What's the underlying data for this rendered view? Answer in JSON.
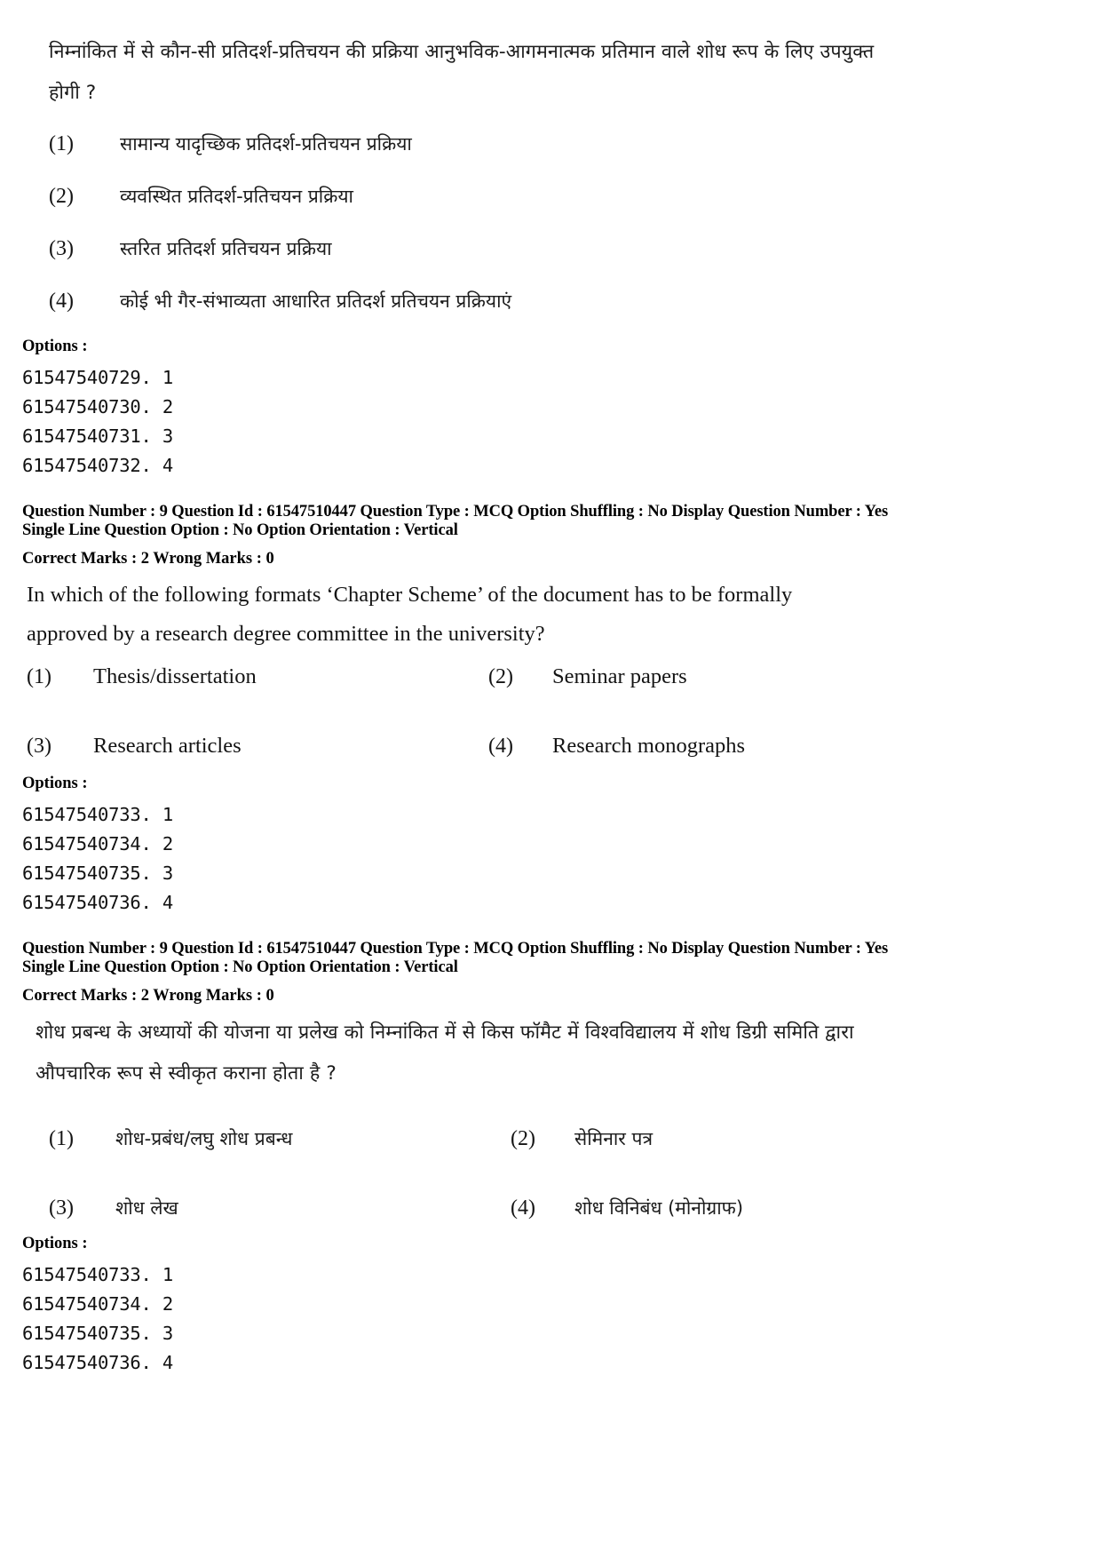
{
  "document": {
    "type": "exam-question-paper-answer-key",
    "language_mix": "Hindi and English"
  },
  "question_1_hindi": {
    "stem_line_1": "निम्नांकित में से कौन-सी प्रतिदर्श-प्रतिचयन की प्रक्रिया आनुभविक-आगमनात्मक प्रतिमान वाले शोध रूप के लिए उपयुक्त",
    "stem_line_2": "होगी ?",
    "options": [
      {
        "number": "(1)",
        "label": "सामान्य यादृच्छिक प्रतिदर्श-प्रतिचयन प्रक्रिया"
      },
      {
        "number": "(2)",
        "label": "व्यवस्थित प्रतिदर्श-प्रतिचयन प्रक्रिया"
      },
      {
        "number": "(3)",
        "label": "स्तरित प्रतिदर्श प्रतिचयन प्रक्रिया"
      },
      {
        "number": "(4)",
        "label": "कोई भी गैर-संभाव्यता आधारित प्रतिदर्श प्रतिचयन प्रक्रियाएं"
      }
    ],
    "options_heading": "Options :",
    "option_ids": [
      "61547540729. 1",
      "61547540730. 2",
      "61547540731. 3",
      "61547540732. 4"
    ]
  },
  "meta_1": {
    "line_1": "Question Number : 9  Question Id : 61547510447  Question Type : MCQ  Option Shuffling : No  Display Question Number : Yes",
    "line_2": "Single Line Question Option : No  Option Orientation : Vertical",
    "marks": "Correct Marks : 2 Wrong Marks : 0"
  },
  "question_2_english": {
    "stem_line_1": "In which of the following formats ‘Chapter Scheme’ of the document has to be formally",
    "stem_line_2": "approved by a research degree committee in the university?",
    "options": [
      {
        "number": "(1)",
        "label": "Thesis/dissertation"
      },
      {
        "number": "(2)",
        "label": "Seminar papers"
      },
      {
        "number": "(3)",
        "label": "Research articles"
      },
      {
        "number": "(4)",
        "label": "Research monographs"
      }
    ],
    "options_heading": "Options :",
    "option_ids": [
      "61547540733. 1",
      "61547540734. 2",
      "61547540735. 3",
      "61547540736. 4"
    ]
  },
  "meta_2": {
    "line_1": "Question Number : 9  Question Id : 61547510447  Question Type : MCQ  Option Shuffling : No  Display Question Number : Yes",
    "line_2": "Single Line Question Option : No  Option Orientation : Vertical",
    "marks": "Correct Marks : 2 Wrong Marks : 0"
  },
  "question_2_hindi": {
    "stem_line_1": "शोध प्रबन्ध के अध्यायों की योजना या प्रलेख को निम्नांकित में से किस फॉमैट में विश्वविद्यालय में शोध डिग्री समिति द्वारा",
    "stem_line_2": "औपचारिक रूप से स्वीकृत कराना होता है ?",
    "options": [
      {
        "number": "(1)",
        "label": "शोध-प्रबंध/लघु शोध प्रबन्ध"
      },
      {
        "number": "(2)",
        "label": "सेमिनार पत्र"
      },
      {
        "number": "(3)",
        "label": "शोध लेख"
      },
      {
        "number": "(4)",
        "label": "शोध विनिबंध (मोनोग्राफ)"
      }
    ],
    "options_heading": "Options :",
    "option_ids": [
      "61547540733. 1",
      "61547540734. 2",
      "61547540735. 3",
      "61547540736. 4"
    ]
  },
  "colors": {
    "page_background": "#ffffff",
    "body_text": "#141414",
    "meta_text": "#000000"
  }
}
